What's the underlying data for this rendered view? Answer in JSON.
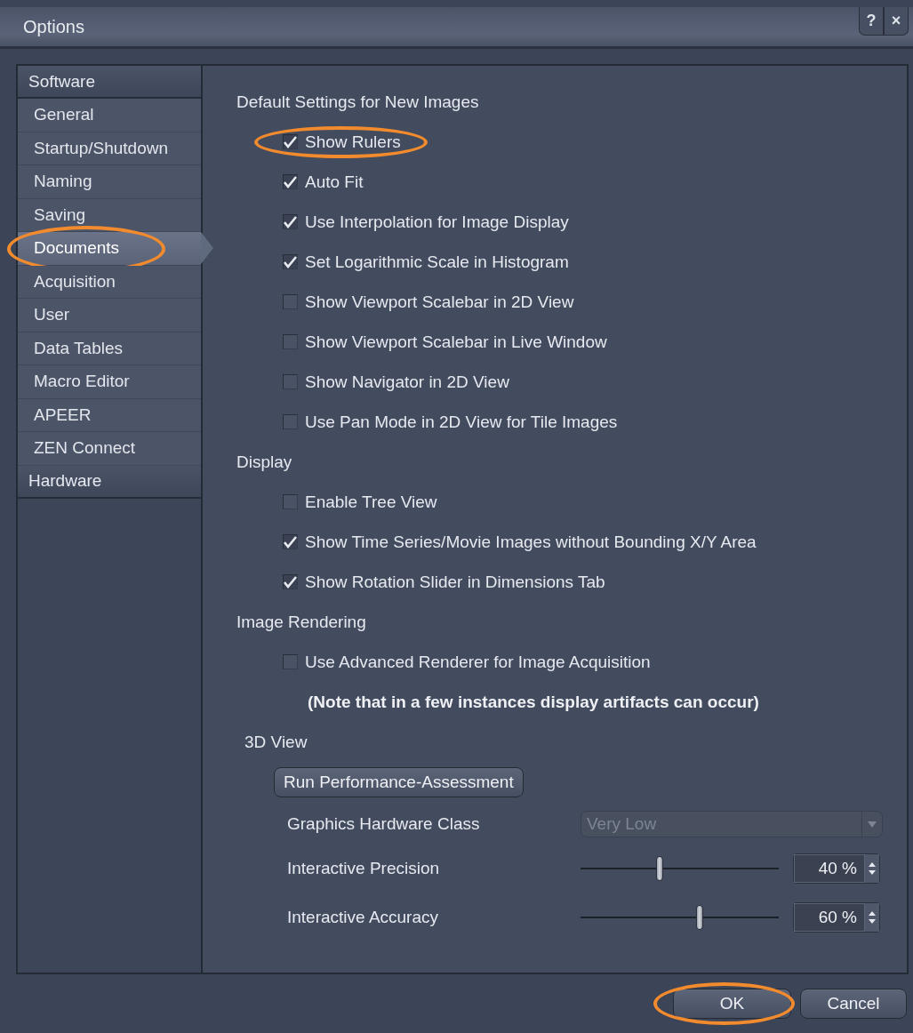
{
  "window": {
    "title": "Options",
    "buttons": [
      "?",
      "×"
    ]
  },
  "sidebar": {
    "groups": [
      {
        "label": "Software",
        "items": [
          {
            "label": "General",
            "selected": false,
            "annotated": false
          },
          {
            "label": "Startup/Shutdown",
            "selected": false,
            "annotated": false
          },
          {
            "label": "Naming",
            "selected": false,
            "annotated": false
          },
          {
            "label": "Saving",
            "selected": false,
            "annotated": false
          },
          {
            "label": "Documents",
            "selected": true,
            "annotated": true
          },
          {
            "label": "Acquisition",
            "selected": false,
            "annotated": false
          },
          {
            "label": "User",
            "selected": false,
            "annotated": false
          },
          {
            "label": "Data Tables",
            "selected": false,
            "annotated": false
          },
          {
            "label": "Macro Editor",
            "selected": false,
            "annotated": false
          },
          {
            "label": "APEER",
            "selected": false,
            "annotated": false
          },
          {
            "label": "ZEN Connect",
            "selected": false,
            "annotated": false
          }
        ]
      },
      {
        "label": "Hardware"
      }
    ]
  },
  "sections": [
    {
      "title": "Default Settings for New Images",
      "rows": [
        {
          "kind": "checkbox",
          "label": "Show Rulers",
          "checked": true,
          "annotated": true
        },
        {
          "kind": "checkbox",
          "label": "Auto Fit",
          "checked": true,
          "annotated": false
        },
        {
          "kind": "checkbox",
          "label": "Use Interpolation for Image Display",
          "checked": true,
          "annotated": false
        },
        {
          "kind": "checkbox",
          "label": "Set Logarithmic Scale in Histogram",
          "checked": true,
          "annotated": false
        },
        {
          "kind": "checkbox",
          "label": "Show Viewport Scalebar in 2D View",
          "checked": false,
          "annotated": false
        },
        {
          "kind": "checkbox",
          "label": "Show Viewport Scalebar in Live Window",
          "checked": false,
          "annotated": false
        },
        {
          "kind": "checkbox",
          "label": "Show Navigator in 2D View",
          "checked": false,
          "annotated": false
        },
        {
          "kind": "checkbox",
          "label": "Use Pan Mode in 2D View for Tile Images",
          "checked": false,
          "annotated": false
        }
      ]
    },
    {
      "title": "Display",
      "rows": [
        {
          "kind": "checkbox",
          "label": "Enable Tree View",
          "checked": false,
          "annotated": false
        },
        {
          "kind": "checkbox",
          "label": "Show Time Series/Movie Images without Bounding X/Y Area",
          "checked": true,
          "annotated": false
        },
        {
          "kind": "checkbox",
          "label": "Show Rotation Slider in Dimensions Tab",
          "checked": true,
          "annotated": false
        }
      ]
    },
    {
      "title": "Image Rendering",
      "rows": [
        {
          "kind": "checkbox",
          "label": "Use Advanced Renderer for Image Acquisition",
          "checked": false,
          "annotated": false
        },
        {
          "kind": "note",
          "label": "(Note that in a few instances display artifacts can occur)"
        }
      ]
    },
    {
      "title": "3D View",
      "rows": [
        {
          "kind": "button",
          "label": "Run Performance-Assessment"
        },
        {
          "kind": "dropdown",
          "label": "Graphics Hardware Class",
          "value": "Very Low",
          "disabled": true
        },
        {
          "kind": "slider",
          "label": "Interactive Precision",
          "level": 0.4,
          "value": "40 %"
        },
        {
          "kind": "slider",
          "label": "Interactive Accuracy",
          "level": 0.6,
          "value": "60 %"
        }
      ]
    }
  ],
  "footer": {
    "buttons": [
      {
        "label": "OK",
        "annotated": true
      },
      {
        "label": "Cancel",
        "annotated": false
      }
    ]
  }
}
